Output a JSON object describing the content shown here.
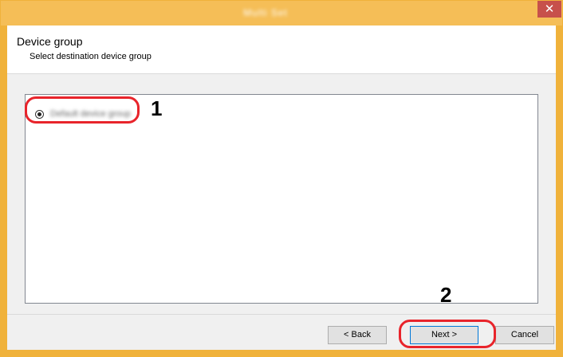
{
  "window": {
    "title": "Multi Set",
    "close_glyph": "✕",
    "accent_color": "#f0b23b"
  },
  "header": {
    "title": "Device group",
    "subtitle": "Select destination device group"
  },
  "list": {
    "items": [
      {
        "label": "Default device group",
        "selected": true
      }
    ]
  },
  "callouts": {
    "first": "1",
    "second": "2",
    "ring_color": "#e8242b"
  },
  "buttons": {
    "back": "< Back",
    "next": "Next >",
    "cancel": "Cancel"
  }
}
